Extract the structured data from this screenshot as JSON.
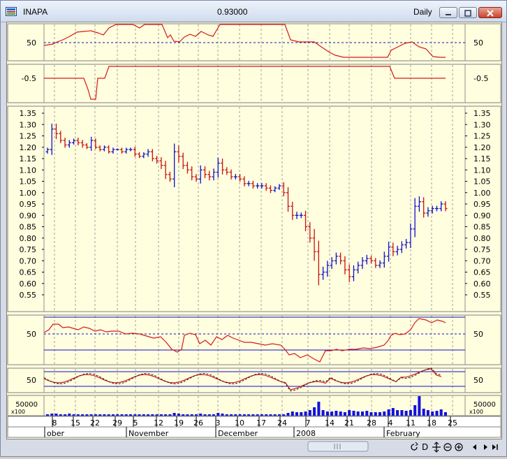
{
  "window": {
    "title": "INAPA",
    "last_value": "0.93000",
    "period": "Daily"
  },
  "panels": {
    "ind1": {
      "label_left": "50",
      "label_right": "50"
    },
    "ind2": {
      "label_left": "-0.5",
      "label_right": "-0.5"
    },
    "price": {
      "ticks": [
        "1.35",
        "1.30",
        "1.25",
        "1.20",
        "1.15",
        "1.10",
        "1.05",
        "1.00",
        "0.95",
        "0.90",
        "0.85",
        "0.80",
        "0.75",
        "0.70",
        "0.65",
        "0.60",
        "0.55"
      ]
    },
    "ind3": {
      "label_left": "50",
      "label_right": "50"
    },
    "ind4": {
      "label_left": "50",
      "label_right": "50"
    },
    "volume": {
      "label_left": "50000",
      "label_right": "50000",
      "multiplier": "x100"
    }
  },
  "xaxis": {
    "days": [
      "8",
      "15",
      "22",
      "29",
      "5",
      "12",
      "19",
      "26",
      "3",
      "10",
      "17",
      "24",
      "7",
      "14",
      "21",
      "28",
      "4",
      "11",
      "18",
      "25"
    ],
    "months": [
      "ober",
      "November",
      "December",
      "2008",
      "February"
    ]
  },
  "toolbar": {
    "icons": [
      "refresh-icon",
      "d-icon",
      "pan-icon",
      "zoom-out-icon",
      "zoom-in-icon",
      "prev-icon",
      "next-icon",
      "end-icon"
    ],
    "d_label": "D"
  },
  "colors": {
    "up": "#1010c8",
    "down": "#c81010",
    "line": "#d81818",
    "grid": "#a0a0a0",
    "bg": "#fffedf",
    "ref": "#1010c0"
  },
  "chart_data": {
    "type": "ohlc",
    "title": "INAPA",
    "ylim": [
      0.52,
      1.38
    ],
    "close": [
      1.19,
      1.28,
      1.26,
      1.23,
      1.21,
      1.22,
      1.23,
      1.22,
      1.21,
      1.2,
      1.23,
      1.2,
      1.19,
      1.2,
      1.18,
      1.19,
      1.19,
      1.18,
      1.19,
      1.19,
      1.17,
      1.16,
      1.17,
      1.18,
      1.15,
      1.14,
      1.12,
      1.08,
      1.06,
      1.18,
      1.16,
      1.12,
      1.1,
      1.07,
      1.06,
      1.1,
      1.08,
      1.07,
      1.09,
      1.13,
      1.1,
      1.09,
      1.07,
      1.07,
      1.06,
      1.04,
      1.04,
      1.03,
      1.03,
      1.03,
      1.02,
      1.01,
      1.02,
      1.03,
      1.0,
      0.94,
      0.9,
      0.9,
      0.9,
      0.85,
      0.8,
      0.74,
      0.64,
      0.65,
      0.68,
      0.7,
      0.72,
      0.7,
      0.66,
      0.63,
      0.66,
      0.68,
      0.7,
      0.71,
      0.7,
      0.68,
      0.69,
      0.72,
      0.76,
      0.74,
      0.75,
      0.77,
      0.78,
      0.84,
      0.94,
      0.96,
      0.91,
      0.92,
      0.93,
      0.93,
      0.95,
      0.93
    ]
  }
}
